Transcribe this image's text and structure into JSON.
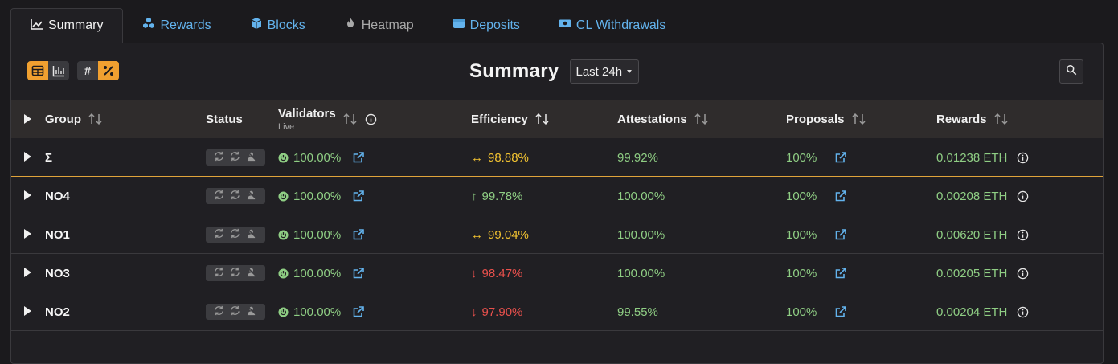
{
  "tabs": [
    {
      "label": "Summary",
      "icon": "chart-line-icon",
      "active": true
    },
    {
      "label": "Rewards",
      "icon": "cubes-icon"
    },
    {
      "label": "Blocks",
      "icon": "cube-icon"
    },
    {
      "label": "Heatmap",
      "icon": "fire-icon",
      "disabled": true
    },
    {
      "label": "Deposits",
      "icon": "wallet-icon"
    },
    {
      "label": "CL Withdrawals",
      "icon": "money-bill-icon"
    }
  ],
  "header": {
    "title": "Summary",
    "period": "Last 24h"
  },
  "columns": {
    "group": "Group",
    "status": "Status",
    "validators": "Validators",
    "validators_sub": "Live",
    "efficiency": "Efficiency",
    "attestations": "Attestations",
    "proposals": "Proposals",
    "rewards": "Rewards"
  },
  "rows": [
    {
      "group": "Σ",
      "validators": "100.00%",
      "efficiency": "98.88%",
      "trend": "↔",
      "trend_color": "#f5c531",
      "attestations": "99.92%",
      "proposals": "100%",
      "rewards": "0.01238 ETH"
    },
    {
      "group": "NO4",
      "validators": "100.00%",
      "efficiency": "99.78%",
      "trend": "↑",
      "trend_color": "#8fce84",
      "attestations": "100.00%",
      "proposals": "100%",
      "rewards": "0.00208 ETH"
    },
    {
      "group": "NO1",
      "validators": "100.00%",
      "efficiency": "99.04%",
      "trend": "↔",
      "trend_color": "#f5c531",
      "attestations": "100.00%",
      "proposals": "100%",
      "rewards": "0.00620 ETH"
    },
    {
      "group": "NO3",
      "validators": "100.00%",
      "efficiency": "98.47%",
      "trend": "↓",
      "trend_color": "#e8504c",
      "attestations": "100.00%",
      "proposals": "100%",
      "rewards": "0.00205 ETH"
    },
    {
      "group": "NO2",
      "validators": "100.00%",
      "efficiency": "97.90%",
      "trend": "↓",
      "trend_color": "#e8504c",
      "attestations": "99.55%",
      "proposals": "100%",
      "rewards": "0.00204 ETH"
    }
  ],
  "colors": {
    "accent": "#f0a030",
    "link": "#63b3ed",
    "good": "#8fce84",
    "warn": "#f5c531",
    "bad": "#e8504c"
  }
}
